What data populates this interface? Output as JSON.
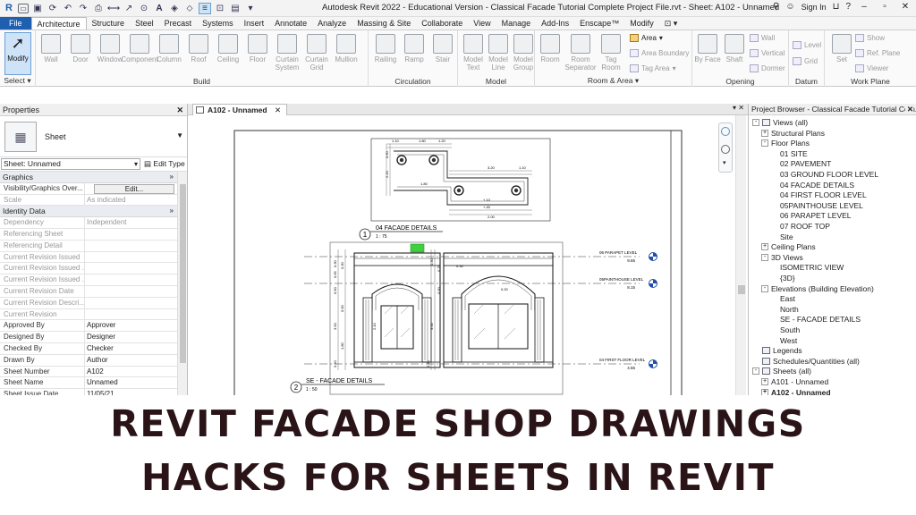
{
  "window": {
    "title": "Autodesk Revit 2022 - Educational Version - Classical Facade Tutorial Complete Project File.rvt - Sheet: A102 - Unnamed",
    "sign_in": "Sign In",
    "brand_letter": "R"
  },
  "menu": {
    "tabs": [
      "File",
      "Architecture",
      "Structure",
      "Steel",
      "Precast",
      "Systems",
      "Insert",
      "Annotate",
      "Analyze",
      "Massing & Site",
      "Collaborate",
      "View",
      "Manage",
      "Add-Ins",
      "Enscape™",
      "Modify"
    ],
    "active": "Architecture"
  },
  "ribbon": {
    "select": {
      "label": "Select",
      "modify": "Modify"
    },
    "build": {
      "label": "Build",
      "buttons": [
        "Wall",
        "Door",
        "Window",
        "Component",
        "Column",
        "Roof",
        "Ceiling",
        "Floor",
        "Curtain System",
        "Curtain Grid",
        "Mullion"
      ]
    },
    "circulation": {
      "label": "Circulation",
      "buttons": [
        "Railing",
        "Ramp",
        "Stair"
      ]
    },
    "model": {
      "label": "Model",
      "buttons": [
        "Model Text",
        "Model Line",
        "Model Group"
      ]
    },
    "room": {
      "label": "Room & Area",
      "buttons": [
        "Room",
        "Room Separator",
        "Tag Room"
      ],
      "small": [
        "Area",
        "Area Boundary",
        "Tag Area"
      ]
    },
    "opening": {
      "label": "Opening",
      "buttons": [
        "By Face",
        "Shaft"
      ],
      "small": [
        "Wall",
        "Vertical",
        "Dormer"
      ]
    },
    "datum": {
      "label": "Datum",
      "small": [
        "Level",
        "Grid"
      ]
    },
    "workplane": {
      "label": "Work Plane",
      "buttons": [
        "Set"
      ],
      "small": [
        "Show",
        "Ref. Plane",
        "Viewer"
      ]
    }
  },
  "properties": {
    "header": "Properties",
    "type_name": "Sheet",
    "selector": "Sheet: Unnamed",
    "edit_type": "Edit Type",
    "groups": [
      {
        "name": "Graphics",
        "rows": [
          {
            "k": "Visibility/Graphics Over...",
            "v": "Edit...",
            "btn": true
          },
          {
            "k": "Scale",
            "v": "As indicated",
            "dim": true
          }
        ]
      },
      {
        "name": "Identity Data",
        "rows": [
          {
            "k": "Dependency",
            "v": "Independent",
            "dim": true
          },
          {
            "k": "Referencing Sheet",
            "v": "",
            "dim": true
          },
          {
            "k": "Referencing Detail",
            "v": "",
            "dim": true
          },
          {
            "k": "Current Revision Issued",
            "v": "",
            "dim": true
          },
          {
            "k": "Current Revision Issued ...",
            "v": "",
            "dim": true
          },
          {
            "k": "Current Revision Issued ...",
            "v": "",
            "dim": true
          },
          {
            "k": "Current Revision Date",
            "v": "",
            "dim": true
          },
          {
            "k": "Current Revision Descri...",
            "v": "",
            "dim": true
          },
          {
            "k": "Current Revision",
            "v": "",
            "dim": true
          },
          {
            "k": "Approved By",
            "v": "Approver"
          },
          {
            "k": "Designed By",
            "v": "Designer"
          },
          {
            "k": "Checked By",
            "v": "Checker"
          },
          {
            "k": "Drawn By",
            "v": "Author"
          },
          {
            "k": "Sheet Number",
            "v": "A102"
          },
          {
            "k": "Sheet Name",
            "v": "Unnamed"
          },
          {
            "k": "Sheet Issue Date",
            "v": "11/05/21"
          }
        ]
      }
    ]
  },
  "view": {
    "tab": "A102 - Unnamed",
    "drawing": {
      "view1_number": "1",
      "view1_title": "04 FACADE DETAILS",
      "view1_scale": "1 : 75",
      "view2_number": "2",
      "view2_title": "SE - FACADE DETAILS",
      "view2_scale": "1 : 50",
      "levels": [
        {
          "name": "06 PARAPET LEVEL",
          "elev": "9.65"
        },
        {
          "name": "05PAINTHOUSE LEVEL",
          "elev": "8.15"
        },
        {
          "name": "04 FIRST FLOOR LEVEL",
          "elev": "4.55"
        }
      ],
      "plan_dims": [
        "1.10",
        "1.80",
        "1.20",
        "3.20",
        "1.10",
        "0.90",
        "2.20",
        "1.80",
        "+.10",
        "+.40",
        "2.00"
      ],
      "elev_dims": [
        "0.30",
        "0.65",
        "0.90",
        "0.30",
        "2.10",
        "0.90",
        "3.50",
        "1.80",
        "0.20",
        "0.30",
        "3.00",
        "0.30",
        "0.75",
        "0.90",
        "0.30",
        "0.20"
      ]
    }
  },
  "browser": {
    "header": "Project Browser - Classical Facade Tutorial Com...",
    "nodes": [
      {
        "label": "Views (all)",
        "level": 0,
        "tog": "-",
        "icon": true
      },
      {
        "label": "Structural Plans",
        "level": 1,
        "tog": "+"
      },
      {
        "label": "Floor Plans",
        "level": 1,
        "tog": "-"
      },
      {
        "label": "01 SITE",
        "level": 2
      },
      {
        "label": "02 PAVEMENT",
        "level": 2
      },
      {
        "label": "03 GROUND FLOOR LEVEL",
        "level": 2
      },
      {
        "label": "04 FACADE DETAILS",
        "level": 2
      },
      {
        "label": "04 FIRST FLOOR LEVEL",
        "level": 2
      },
      {
        "label": "05PAINTHOUSE LEVEL",
        "level": 2
      },
      {
        "label": "06 PARAPET LEVEL",
        "level": 2
      },
      {
        "label": "07 ROOF TOP",
        "level": 2
      },
      {
        "label": "Site",
        "level": 2
      },
      {
        "label": "Ceiling Plans",
        "level": 1,
        "tog": "+"
      },
      {
        "label": "3D Views",
        "level": 1,
        "tog": "-"
      },
      {
        "label": "ISOMETRIC VIEW",
        "level": 2
      },
      {
        "label": "{3D}",
        "level": 2
      },
      {
        "label": "Elevations (Building Elevation)",
        "level": 1,
        "tog": "-"
      },
      {
        "label": "East",
        "level": 2
      },
      {
        "label": "North",
        "level": 2
      },
      {
        "label": "SE - FACADE DETAILS",
        "level": 2
      },
      {
        "label": "South",
        "level": 2
      },
      {
        "label": "West",
        "level": 2
      },
      {
        "label": "Legends",
        "level": 0,
        "icon": true
      },
      {
        "label": "Schedules/Quantities (all)",
        "level": 0,
        "icon": true
      },
      {
        "label": "Sheets (all)",
        "level": 0,
        "tog": "-",
        "icon": true
      },
      {
        "label": "A101 - Unnamed",
        "level": 1,
        "tog": "+"
      },
      {
        "label": "A102 - Unnamed",
        "level": 1,
        "tog": "+",
        "bold": true
      }
    ]
  },
  "banner": {
    "line1": "REVIT FACADE SHOP DRAWINGS",
    "line2": "HACKS FOR SHEETS IN REVIT"
  },
  "colors": {
    "file_tab": "#1f5fb0",
    "banner_text": "#2a1418",
    "highlight": "#cfe3f8"
  }
}
